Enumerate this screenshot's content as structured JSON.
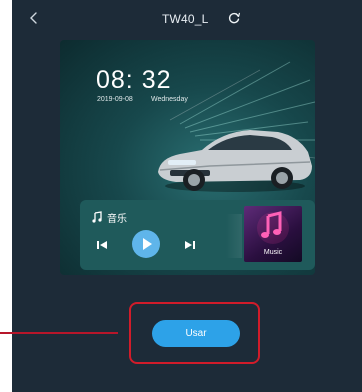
{
  "header": {
    "title": "TW40_L"
  },
  "preview": {
    "time": "08: 32",
    "date": "2019-09-08",
    "weekday": "Wednesday"
  },
  "music": {
    "label": "音乐",
    "album_caption": "Music"
  },
  "actions": {
    "use_label": "Usar"
  },
  "colors": {
    "background": "#1d2b38",
    "accent": "#2da2e8",
    "highlight": "#d11c2a"
  },
  "icons": [
    "back-icon",
    "refresh-icon",
    "music-note-icon",
    "previous-icon",
    "play-icon",
    "next-icon"
  ]
}
